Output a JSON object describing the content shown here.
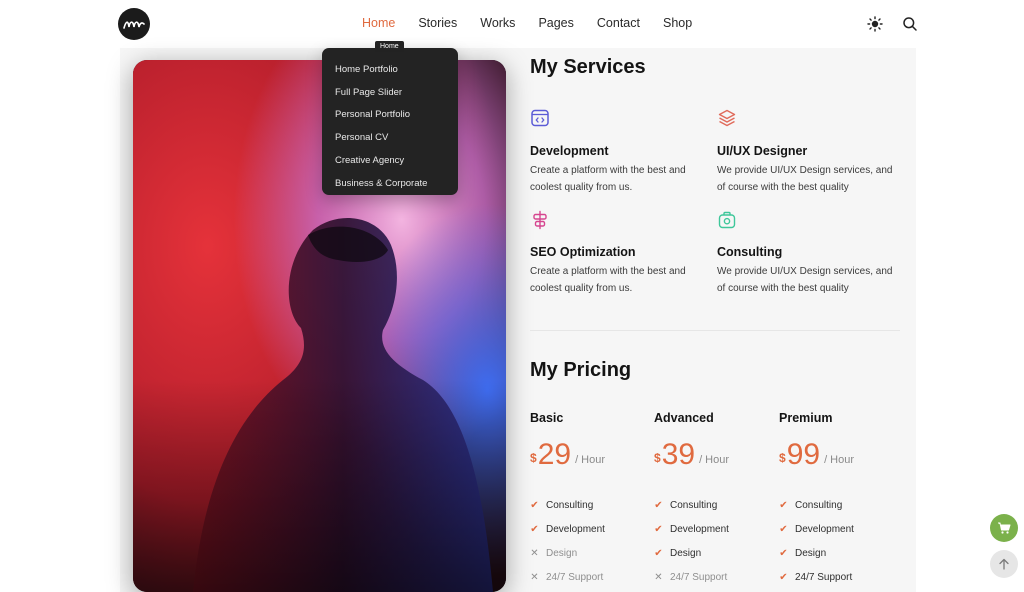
{
  "header": {
    "nav": [
      {
        "label": "Home",
        "active": true
      },
      {
        "label": "Stories",
        "active": false
      },
      {
        "label": "Works",
        "active": false
      },
      {
        "label": "Pages",
        "active": false
      },
      {
        "label": "Contact",
        "active": false
      },
      {
        "label": "Shop",
        "active": false
      }
    ],
    "icons": [
      "sun-icon",
      "search-icon"
    ]
  },
  "dropdown": {
    "tooltip": "Home",
    "items": [
      "Home Portfolio",
      "Full Page Slider",
      "Personal Portfolio",
      "Personal CV",
      "Creative Agency",
      "Business & Corporate"
    ]
  },
  "services": {
    "title": "My Services",
    "items": [
      {
        "icon": "code-window-icon",
        "color": "#5b5bd6",
        "title": "Development",
        "desc": "Create a platform with the best and coolest quality from us."
      },
      {
        "icon": "layers-icon",
        "color": "#e06a5a",
        "title": "UI/UX Designer",
        "desc": "We provide UI/UX Design services, and of course with the best quality"
      },
      {
        "icon": "align-center-icon",
        "color": "#d6458f",
        "title": "SEO Optimization",
        "desc": "Create a platform with the best and coolest quality from us."
      },
      {
        "icon": "camera-bag-icon",
        "color": "#3ec79a",
        "title": "Consulting",
        "desc": "We provide UI/UX Design services, and of course with the best quality"
      }
    ]
  },
  "pricing": {
    "title": "My Pricing",
    "plans": [
      {
        "name": "Basic",
        "currency": "$",
        "amount": "29",
        "per": "/ Hour",
        "features": [
          {
            "text": "Consulting",
            "on": true
          },
          {
            "text": "Development",
            "on": true
          },
          {
            "text": "Design",
            "on": false
          },
          {
            "text": "24/7 Support",
            "on": false
          }
        ]
      },
      {
        "name": "Advanced",
        "currency": "$",
        "amount": "39",
        "per": "/ Hour",
        "features": [
          {
            "text": "Consulting",
            "on": true
          },
          {
            "text": "Development",
            "on": true
          },
          {
            "text": "Design",
            "on": true
          },
          {
            "text": "24/7 Support",
            "on": false
          }
        ]
      },
      {
        "name": "Premium",
        "currency": "$",
        "amount": "99",
        "per": "/ Hour",
        "features": [
          {
            "text": "Consulting",
            "on": true
          },
          {
            "text": "Development",
            "on": true
          },
          {
            "text": "Design",
            "on": true
          },
          {
            "text": "24/7 Support",
            "on": true
          }
        ]
      }
    ],
    "check_glyph": "✔",
    "cross_glyph": "✕"
  },
  "colors": {
    "accent": "#e06a3f",
    "cart": "#7bb14b",
    "panel": "#f6f6f6",
    "dropdown": "#232323"
  },
  "floating": {
    "cart_icon": "cart-icon",
    "top_icon": "arrow-up-icon"
  }
}
